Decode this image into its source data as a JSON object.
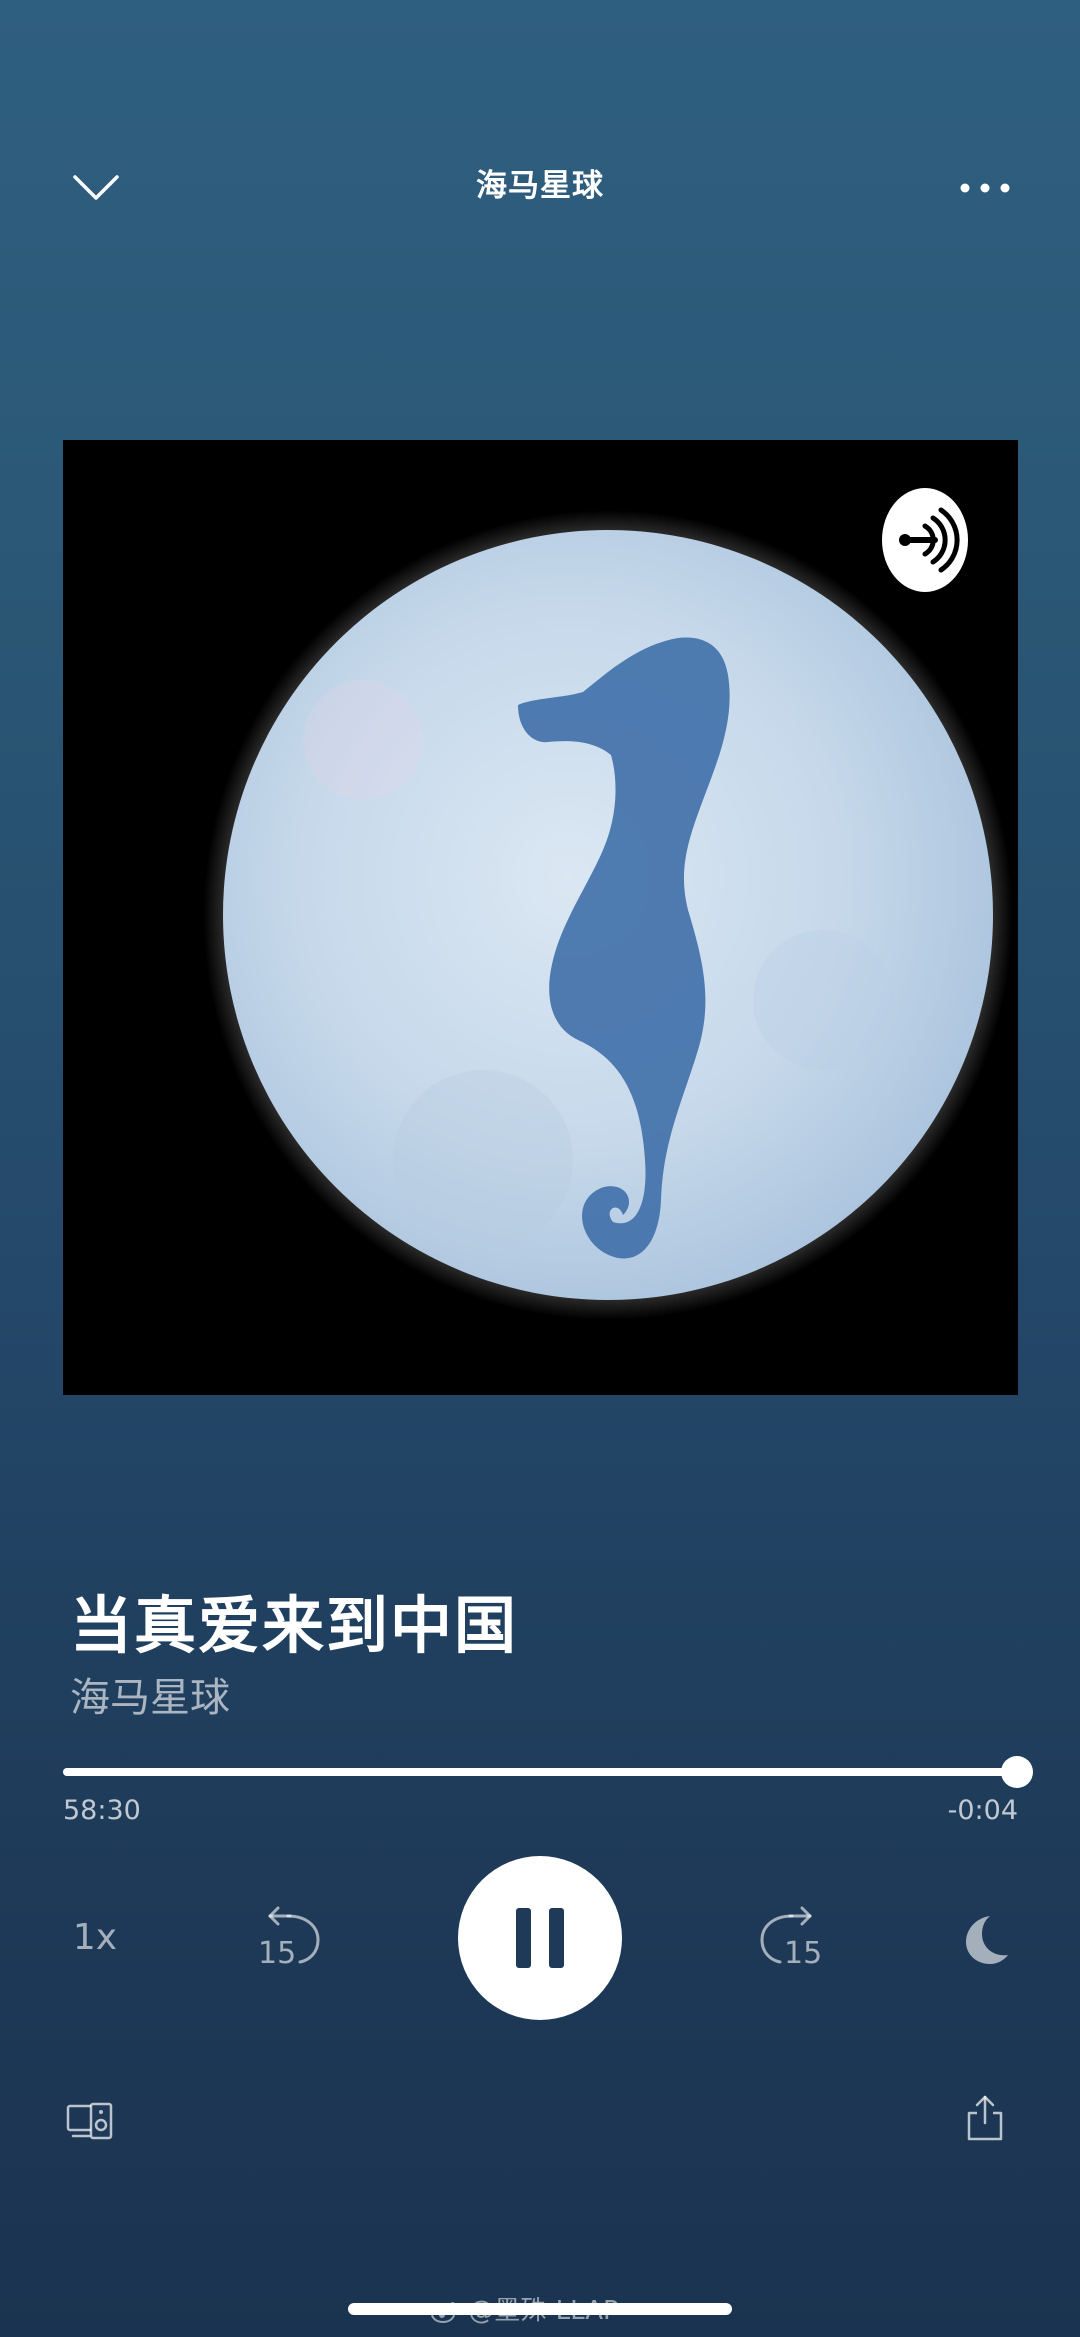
{
  "header": {
    "title": "海马星球",
    "collapse_icon": "chevron-down-icon",
    "more_icon": "more-dots-icon"
  },
  "artwork": {
    "badge_icon": "anchor-podcast-icon"
  },
  "episode": {
    "title": "当真爱来到中国",
    "show": "海马星球"
  },
  "progress": {
    "elapsed": "58:30",
    "remaining": "-0:04",
    "fraction": 0.999
  },
  "controls": {
    "speed_label": "1x",
    "rewind_seconds": "15",
    "forward_seconds": "15",
    "play_state": "pause-icon",
    "sleep_icon": "moon-icon"
  },
  "footer": {
    "devices_icon": "devices-icon",
    "share_icon": "share-icon"
  },
  "watermark": {
    "text": "@墨殊-LLAP"
  },
  "colors": {
    "background_top": "#2f5f80",
    "background_bottom": "#1a3350",
    "accent": "#ffffff"
  }
}
